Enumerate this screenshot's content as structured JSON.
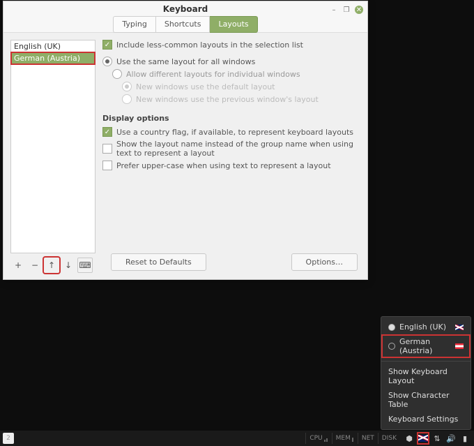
{
  "window": {
    "title": "Keyboard",
    "tabs": [
      "Typing",
      "Shortcuts",
      "Layouts"
    ],
    "activeTab": "Layouts"
  },
  "layouts": {
    "items": [
      {
        "label": "English (UK)"
      },
      {
        "label": "German (Austria)",
        "selected": true
      }
    ]
  },
  "toolbar": {
    "reset": "Reset to Defaults",
    "options": "Options…"
  },
  "settings": {
    "include_less_common": "Include less-common layouts in the selection list",
    "same_for_all": "Use the same layout for all windows",
    "allow_diff": "Allow different layouts for individual windows",
    "new_use_default": "New windows use the default layout",
    "new_use_previous": "New windows use the previous window's layout",
    "display_heading": "Display options",
    "use_flag": "Use a country flag, if available, to represent keyboard layouts",
    "show_layout_name": "Show the layout name instead of the group name when using text to represent a layout",
    "prefer_upper": "Prefer upper-case when using text to represent a layout"
  },
  "popup": {
    "items": [
      {
        "label": "English (UK)",
        "sel": true,
        "flag": "uk"
      },
      {
        "label": "German (Austria)",
        "sel": false,
        "flag": "at"
      }
    ],
    "actions": [
      "Show Keyboard Layout",
      "Show Character Table",
      "Keyboard Settings"
    ]
  },
  "taskbar": {
    "monitors": [
      "CPU",
      "MEM",
      "NET",
      "DISK"
    ]
  }
}
